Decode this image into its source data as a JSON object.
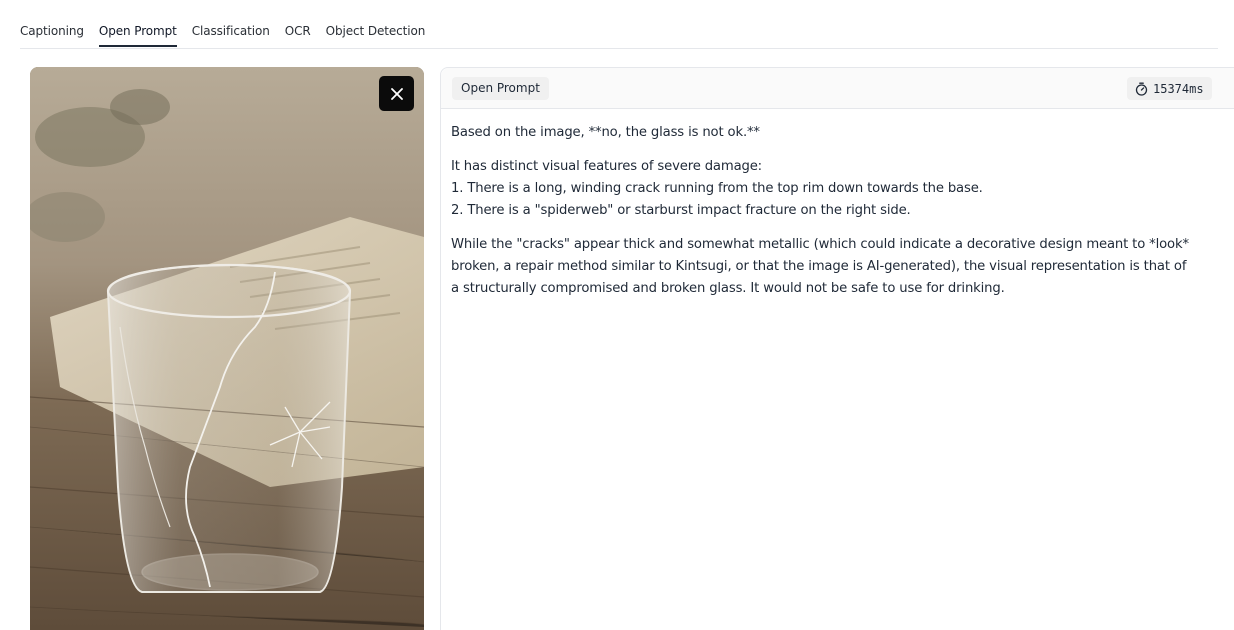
{
  "tabs": [
    {
      "label": "Captioning",
      "active": false
    },
    {
      "label": "Open Prompt",
      "active": true
    },
    {
      "label": "Classification",
      "active": false
    },
    {
      "label": "OCR",
      "active": false
    },
    {
      "label": "Object Detection",
      "active": false
    }
  ],
  "image_panel": {
    "close_icon": "close-icon"
  },
  "result": {
    "mode_label": "Open Prompt",
    "timer_icon": "timer-icon",
    "timing": "15374ms",
    "paragraphs": [
      [
        "Based on the image, **no, the glass is not ok.**"
      ],
      [
        "It has distinct visual features of severe damage:",
        "1.  There is a long, winding crack running from the top rim down towards the base.",
        "2.  There is a \"spiderweb\" or starburst impact fracture on the right side."
      ],
      [
        "While the \"cracks\" appear thick and somewhat metallic (which could indicate a decorative design meant to *look*",
        "broken, a repair method similar to Kintsugi, or that the image is AI-generated), the visual representation is that of",
        "a structurally compromised and broken glass. It would not be safe to use for drinking."
      ]
    ]
  },
  "colors": {
    "active_tab_underline": "#1f2937",
    "close_button_bg": "#0b0b0b",
    "header_bg": "#fafafa",
    "badge_bg": "#f0f0f0"
  }
}
